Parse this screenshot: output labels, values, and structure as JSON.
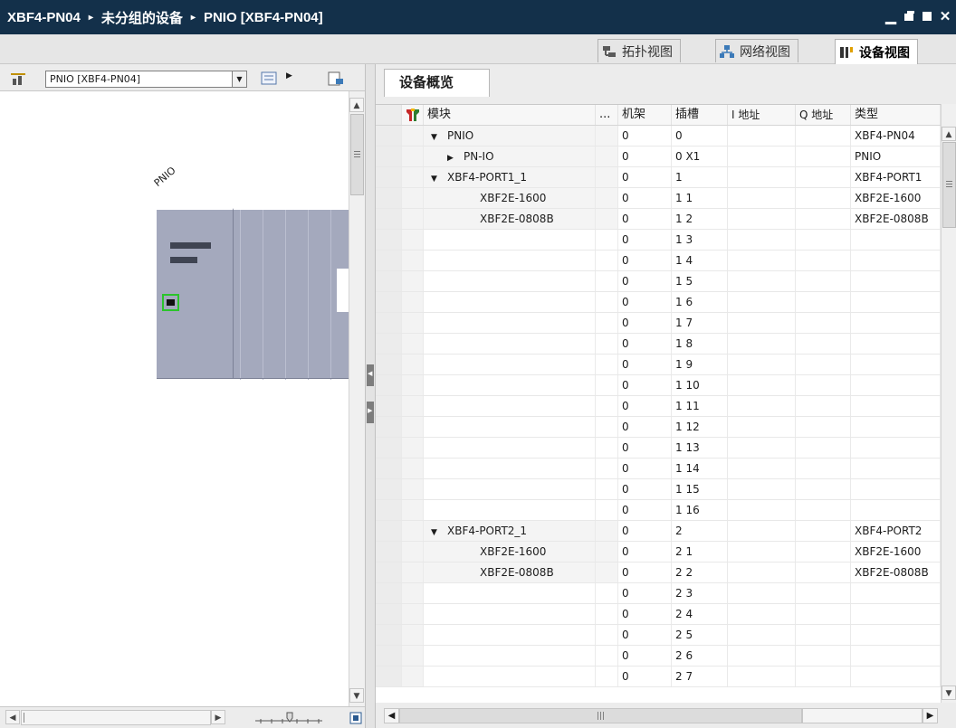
{
  "title_bar": {
    "crumbs": [
      "XBF4-PN04",
      "未分组的设备",
      "PNIO [XBF4-PN04]"
    ],
    "separator": "▸"
  },
  "view_tabs": [
    {
      "label": "拓扑视图",
      "icon": "topology-icon",
      "active": false
    },
    {
      "label": "网络视图",
      "icon": "network-icon",
      "active": false
    },
    {
      "label": "设备视图",
      "icon": "device-icon",
      "active": true
    }
  ],
  "left_toolbar": {
    "device_selector_value": "PNIO [XBF4-PN04]"
  },
  "canvas": {
    "device_label": "PNIO"
  },
  "overview": {
    "tab_label": "设备概览",
    "columns": {
      "module": "模块",
      "dots": "...",
      "rack": "机架",
      "slot": "插槽",
      "i_addr": "I 地址",
      "q_addr": "Q 地址",
      "type": "类型"
    },
    "rows": [
      {
        "expander": "▼",
        "indent": 0,
        "module": "PNIO",
        "rack": "0",
        "slot": "0",
        "type": "XBF4-PN04",
        "shaded": true
      },
      {
        "expander": "▶",
        "indent": 1,
        "module": "PN-IO",
        "rack": "0",
        "slot": "0 X1",
        "type": "PNIO",
        "shaded": true
      },
      {
        "expander": "▼",
        "indent": 0,
        "module": "XBF4-PORT1_1",
        "rack": "0",
        "slot": "1",
        "type": "XBF4-PORT1",
        "shaded": true
      },
      {
        "expander": "",
        "indent": 2,
        "module": "XBF2E-1600",
        "rack": "0",
        "slot": "1 1",
        "type": "XBF2E-1600",
        "shaded": true
      },
      {
        "expander": "",
        "indent": 2,
        "module": "XBF2E-0808B",
        "rack": "0",
        "slot": "1 2",
        "type": "XBF2E-0808B",
        "shaded": true
      },
      {
        "expander": "",
        "indent": 0,
        "module": "",
        "rack": "0",
        "slot": "1 3",
        "type": "",
        "shaded": false
      },
      {
        "expander": "",
        "indent": 0,
        "module": "",
        "rack": "0",
        "slot": "1 4",
        "type": "",
        "shaded": false
      },
      {
        "expander": "",
        "indent": 0,
        "module": "",
        "rack": "0",
        "slot": "1 5",
        "type": "",
        "shaded": false
      },
      {
        "expander": "",
        "indent": 0,
        "module": "",
        "rack": "0",
        "slot": "1 6",
        "type": "",
        "shaded": false
      },
      {
        "expander": "",
        "indent": 0,
        "module": "",
        "rack": "0",
        "slot": "1 7",
        "type": "",
        "shaded": false
      },
      {
        "expander": "",
        "indent": 0,
        "module": "",
        "rack": "0",
        "slot": "1 8",
        "type": "",
        "shaded": false
      },
      {
        "expander": "",
        "indent": 0,
        "module": "",
        "rack": "0",
        "slot": "1 9",
        "type": "",
        "shaded": false
      },
      {
        "expander": "",
        "indent": 0,
        "module": "",
        "rack": "0",
        "slot": "1 10",
        "type": "",
        "shaded": false
      },
      {
        "expander": "",
        "indent": 0,
        "module": "",
        "rack": "0",
        "slot": "1 11",
        "type": "",
        "shaded": false
      },
      {
        "expander": "",
        "indent": 0,
        "module": "",
        "rack": "0",
        "slot": "1 12",
        "type": "",
        "shaded": false
      },
      {
        "expander": "",
        "indent": 0,
        "module": "",
        "rack": "0",
        "slot": "1 13",
        "type": "",
        "shaded": false
      },
      {
        "expander": "",
        "indent": 0,
        "module": "",
        "rack": "0",
        "slot": "1 14",
        "type": "",
        "shaded": false
      },
      {
        "expander": "",
        "indent": 0,
        "module": "",
        "rack": "0",
        "slot": "1 15",
        "type": "",
        "shaded": false
      },
      {
        "expander": "",
        "indent": 0,
        "module": "",
        "rack": "0",
        "slot": "1 16",
        "type": "",
        "shaded": false
      },
      {
        "expander": "▼",
        "indent": 0,
        "module": "XBF4-PORT2_1",
        "rack": "0",
        "slot": "2",
        "type": "XBF4-PORT2",
        "shaded": true
      },
      {
        "expander": "",
        "indent": 2,
        "module": "XBF2E-1600",
        "rack": "0",
        "slot": "2 1",
        "type": "XBF2E-1600",
        "shaded": true
      },
      {
        "expander": "",
        "indent": 2,
        "module": "XBF2E-0808B",
        "rack": "0",
        "slot": "2 2",
        "type": "XBF2E-0808B",
        "shaded": true
      },
      {
        "expander": "",
        "indent": 0,
        "module": "",
        "rack": "0",
        "slot": "2 3",
        "type": "",
        "shaded": false
      },
      {
        "expander": "",
        "indent": 0,
        "module": "",
        "rack": "0",
        "slot": "2 4",
        "type": "",
        "shaded": false
      },
      {
        "expander": "",
        "indent": 0,
        "module": "",
        "rack": "0",
        "slot": "2 5",
        "type": "",
        "shaded": false
      },
      {
        "expander": "",
        "indent": 0,
        "module": "",
        "rack": "0",
        "slot": "2 6",
        "type": "",
        "shaded": false
      },
      {
        "expander": "",
        "indent": 0,
        "module": "",
        "rack": "0",
        "slot": "2 7",
        "type": "",
        "shaded": false
      }
    ]
  },
  "colors": {
    "title_bar": "#13304a",
    "module_body": "#a4a9bd",
    "port_highlight": "#2bc42b"
  }
}
